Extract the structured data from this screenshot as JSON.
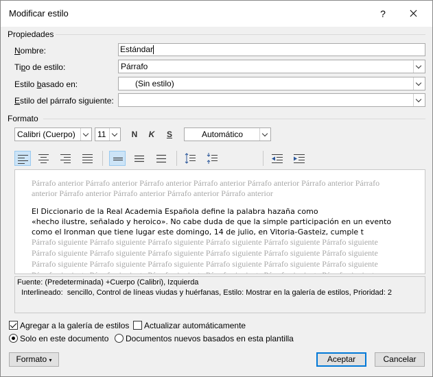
{
  "dialog": {
    "title": "Modificar estilo",
    "help": "?"
  },
  "properties": {
    "section": "Propiedades",
    "name_label": "Nombre:",
    "name_value": "Estándar",
    "type_label": "Tipo de estilo:",
    "type_value": "Párrafo",
    "based_label": "Estilo basado en:",
    "based_value": "(Sin estilo)",
    "next_label": "Estilo del párrafo siguiente:",
    "next_value": ""
  },
  "format": {
    "section": "Formato",
    "font": "Calibri (Cuerpo)",
    "size": "11",
    "bold": "N",
    "italic": "K",
    "underline": "S",
    "color": "Automático"
  },
  "toolbar": {
    "icons": [
      "align-left-icon",
      "align-center-icon",
      "align-right-icon",
      "justify-icon",
      "single-spacing-icon",
      "one-half-spacing-icon",
      "double-spacing-icon",
      "increase-paragraph-spacing-icon",
      "decrease-paragraph-spacing-icon",
      "decrease-indent-icon",
      "increase-indent-icon"
    ]
  },
  "preview": {
    "prev_line1": "Párrafo anterior Párrafo anterior Párrafo anterior Párrafo anterior Párrafo anterior Párrafo anterior Párrafo",
    "prev_line2": "anterior Párrafo anterior Párrafo anterior Párrafo anterior Párrafo anterior",
    "main_line1": "El Diccionario de la Real Academia Española define la palabra hazaña como",
    "main_line2": "«hecho ilustre, señalado y heroico». No cabe duda de que la simple participación en un evento",
    "main_line3": "como el Ironman que tiene lugar este domingo, 14 de julio, en Vitoria-Gasteiz, cumple t",
    "next_line": "Párrafo siguiente Párrafo siguiente Párrafo siguiente Párrafo siguiente Párrafo siguiente Párrafo siguiente"
  },
  "description": {
    "line1": "Fuente: (Predeterminada) +Cuerpo (Calibri), Izquierda",
    "line2": "  Interlineado:  sencillo, Control de líneas viudas y huérfanas, Estilo: Mostrar en la galería de estilos, Prioridad: 2"
  },
  "options": {
    "add_gallery": "Agregar a la galería de estilos",
    "auto_update": "Actualizar automáticamente",
    "only_doc": "Solo en este documento",
    "new_docs": "Documentos nuevos basados en esta plantilla"
  },
  "buttons": {
    "format": "Formato",
    "ok": "Aceptar",
    "cancel": "Cancelar"
  },
  "colors": {
    "accent": "#0078d7",
    "selected_tool": "#cce4f7"
  }
}
